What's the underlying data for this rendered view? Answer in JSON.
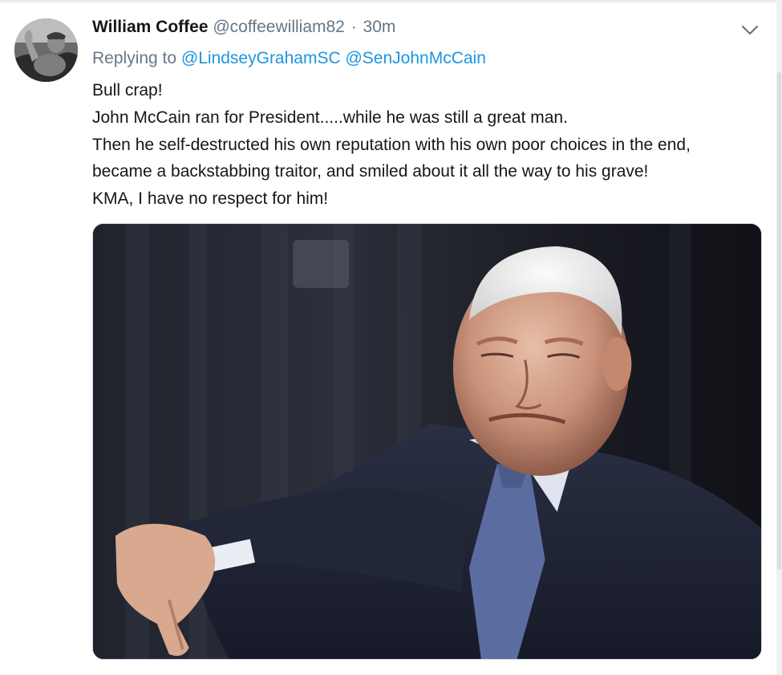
{
  "tweet": {
    "author_name": "William Coffee",
    "author_handle": "@coffeewilliam82",
    "separator": "·",
    "time": "30m",
    "reply_prefix": "Replying to",
    "reply_mentions": [
      "@LindseyGrahamSC",
      "@SenJohnMcCain"
    ],
    "text_lines": [
      "Bull crap!",
      "John McCain ran for President.....while he was still a great man.",
      "Then he self-destructed his own reputation with his own poor choices in the end,",
      "became a backstabbing traitor, and smiled about it all the way to his grave!",
      "KMA, I have no respect for him!"
    ]
  },
  "icons": {
    "menu": "chevron-down-icon"
  },
  "colors": {
    "text": "#14171a",
    "secondary": "#657786",
    "link": "#1b95e0",
    "border": "#e6ecf0"
  }
}
